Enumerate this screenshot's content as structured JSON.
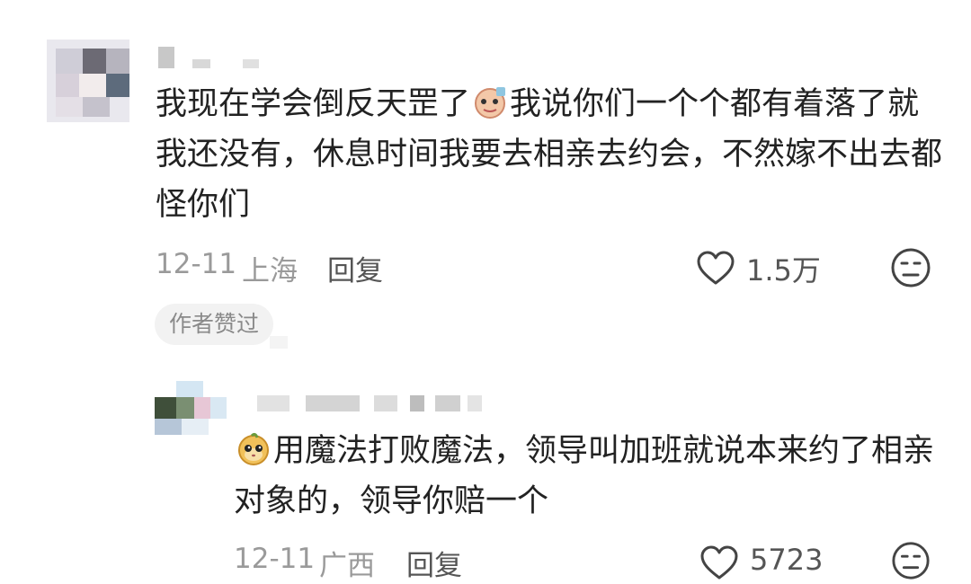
{
  "comment": {
    "text_before_emoji": "我现在学会倒反天罡了",
    "emoji": "sticker-face",
    "text_after_emoji": "我说你们一个个都有着落了就我还没有，休息时间我要去相亲去约会，不然嫁不出去都怪你们",
    "date": "12-11",
    "location": "上海",
    "reply_label": "回复",
    "like_count": "1.5万",
    "author_liked_badge": "作者赞过"
  },
  "reply_comment": {
    "emoji": "monkey-face",
    "text": "用魔法打败魔法，领导叫加班就说本来约了相亲对象的，领导你赔一个",
    "date": "12-11",
    "location": "广西",
    "reply_label": "回复",
    "like_count": "5723"
  },
  "colors": {
    "meta_gray": "#9a9a9a",
    "badge_bg": "#f2f2f2"
  }
}
